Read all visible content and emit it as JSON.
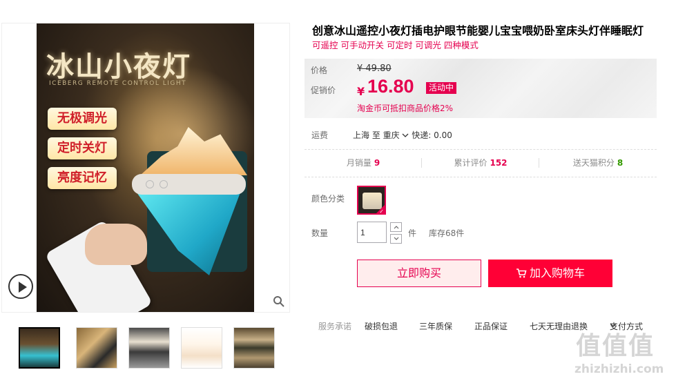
{
  "product": {
    "title": "创意冰山遥控小夜灯插电护眼节能婴儿宝宝喂奶卧室床头灯伴睡眠灯",
    "subtitle": "可遥控 可手动开关 可定时 可调光 四种模式"
  },
  "main_image": {
    "title": "冰山小夜灯",
    "subtitle": "ICEBERG REMOTE CONTROL LIGHT",
    "features": [
      "无极调光",
      "定时关灯",
      "亮度记忆"
    ]
  },
  "price": {
    "orig_label": "价格",
    "orig_value": "¥ 49.80",
    "promo_label": "促销价",
    "currency": "¥",
    "promo_value": "16.80",
    "promo_tag": "活动中",
    "coin_note": "淘金币可抵扣商品价格2%"
  },
  "shipping": {
    "label": "运费",
    "route": "上海 至 重庆",
    "fee": "快递: 0.00"
  },
  "stats": [
    {
      "label": "月销量",
      "value": "9"
    },
    {
      "label": "累计评价",
      "value": "152"
    },
    {
      "label": "送天猫积分",
      "value": "8"
    }
  ],
  "colors": {
    "stat_red": "#e5004f",
    "stat_green": "#339900"
  },
  "sku": {
    "color_label": "颜色分类"
  },
  "quantity": {
    "label": "数量",
    "value": "1",
    "unit": "件",
    "stock": "库存68件"
  },
  "actions": {
    "buy_now": "立即购买",
    "add_cart": "加入购物车"
  },
  "service": {
    "label": "服务承诺",
    "items": [
      "破损包退",
      "三年质保",
      "正品保证",
      "七天无理由退换"
    ],
    "payment": "支付方式"
  },
  "watermark": {
    "glyphs": "值值值",
    "site": "zhizhizhi.com"
  }
}
